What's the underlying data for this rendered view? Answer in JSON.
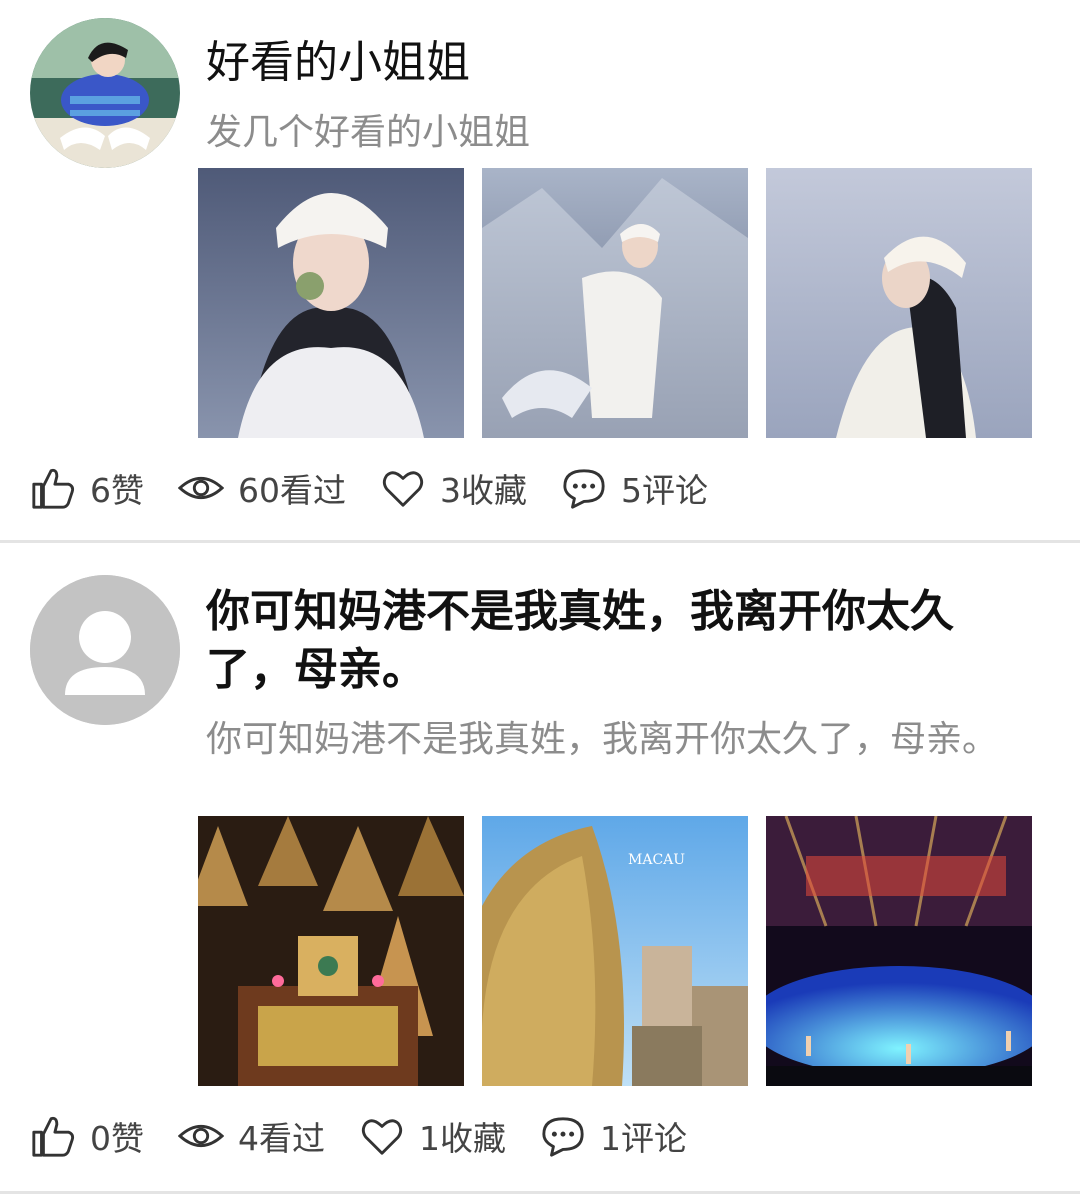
{
  "posts": [
    {
      "title": "好看的小姐姐",
      "subtitle": "发几个好看的小姐姐",
      "avatar": "user-avatar-boy-illustration",
      "images": [
        "snow-girl-photo-1",
        "snow-girl-photo-2",
        "snow-girl-photo-3"
      ],
      "stats": {
        "likes": "6赞",
        "views": "60看过",
        "favorites": "3收藏",
        "comments": "5评论"
      }
    },
    {
      "title": "你可知妈港不是我真姓，我离开你太久了，母亲。",
      "subtitle": "你可知妈港不是我真姓，我离开你太久了，母亲。",
      "avatar": "default-avatar",
      "images": [
        "temple-incense-photo",
        "macau-lisboa-photo",
        "water-show-photo"
      ],
      "stats": {
        "likes": "0赞",
        "views": "4看过",
        "favorites": "1收藏",
        "comments": "1评论"
      }
    }
  ],
  "icons": {
    "like": "thumbs-up-icon",
    "view": "eye-icon",
    "favorite": "heart-icon",
    "comment": "comment-bubble-icon"
  },
  "colors": {
    "divider": "#e4e4e4",
    "subtitle": "#8c8c8c",
    "stat_text": "#444444",
    "default_avatar_bg": "#c3c3c3"
  },
  "image_watermark": {
    "text": "MACAU"
  }
}
